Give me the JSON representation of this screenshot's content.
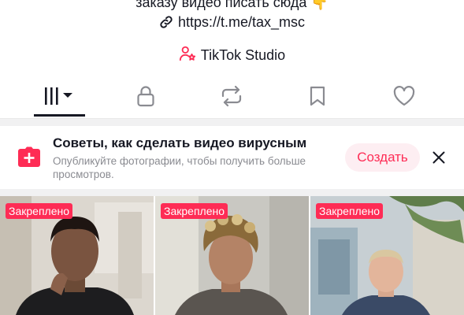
{
  "profile": {
    "bio_line1": "заказу видео писать сюда 👇",
    "bio_link": "https://t.me/tax_msc",
    "studio_label": "TikTok Studio"
  },
  "tabs": [
    {
      "icon": "videos-grid-icon",
      "active": true
    },
    {
      "icon": "lock-icon",
      "active": false
    },
    {
      "icon": "repost-icon",
      "active": false
    },
    {
      "icon": "bookmark-icon",
      "active": false
    },
    {
      "icon": "heart-icon",
      "active": false
    }
  ],
  "tip": {
    "title": "Советы, как сделать видео вирусным",
    "text": "Опубликуйте фотографии, чтобы получить больше просмотров.",
    "create_label": "Создать"
  },
  "videos": [
    {
      "badge": "Закреплено"
    },
    {
      "badge": "Закреплено"
    },
    {
      "badge": "Закреплено"
    }
  ],
  "colors": {
    "accent": "#fe2c55",
    "text": "#161823",
    "secondary_text": "#8a8b91",
    "create_button_bg": "#fdeef2"
  }
}
